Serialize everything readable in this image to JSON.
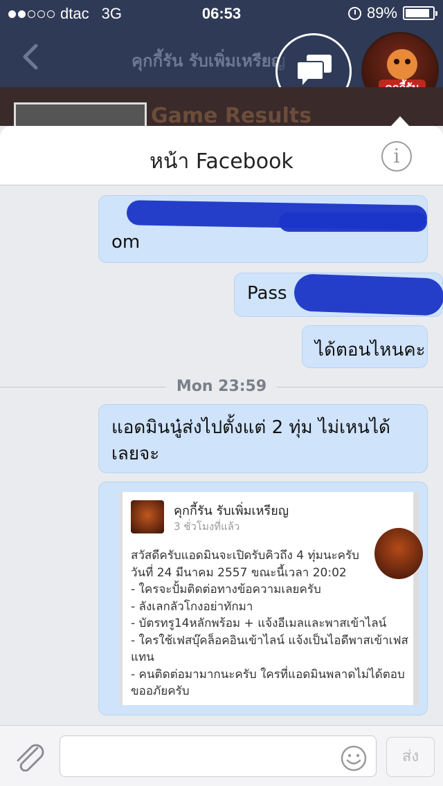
{
  "status_bar": {
    "carrier": "dtac",
    "network": "3G",
    "time": "06:53",
    "battery": "89%",
    "signal_dots_filled": 2,
    "signal_dots_total": 5,
    "battery_level": 0.89
  },
  "nav": {
    "title": "คุกกี้รัน รับเพิ่มเหรียญ",
    "back_icon": "chevron-left-icon",
    "chat_icon": "chat-bubbles-icon"
  },
  "peek": {
    "text": "Game Results"
  },
  "popover": {
    "title": "หน้า Facebook",
    "info_icon": "info-icon"
  },
  "messages": [
    {
      "text": "om"
    },
    {
      "text": "Pass"
    },
    {
      "text": "ได้ตอนไหนคะ"
    },
    {
      "text": "แอดมินนู๋ส่งไปตั้งแต่ 2 ทุ่ม ไม่เหนได้เลยจะ"
    }
  ],
  "timestamp": "Mon 23:59",
  "shared_post": {
    "name": "คุกกี้รัน รับเพิ่มเหรียญ",
    "time": "3 ชั่วโมงที่แล้ว",
    "lines": [
      "สวัสดีครับแอดมินจะเปิดรับคิวถึง 4 ทุ่มนะครับ",
      "วันที่ 24 มีนาคม 2557 ขณะนี้เวลา 20:02",
      "- ใครจะปั้มติดต่อทางข้อความเลยครับ",
      "- ลังเลกลัวโกงอย่าทักมา",
      "- บัตรทรู14หลักพร้อม + แจ้งอีเมลและพาสเข้าไลน์",
      "- ใครใช้เฟสบุ๊คล็อคอินเข้าไลน์ แจ้งเป็นไอดีพาสเข้าเฟส",
      "แทน",
      "- คนติดต่อมามากนะครับ ใครที่แอดมินพลาดไม่ได้ตอบ",
      "ขออภัยครับ"
    ]
  },
  "composer": {
    "placeholder": "",
    "send_label": "ส่ง",
    "attach_icon": "paperclip-icon",
    "emoji_icon": "smiley-icon"
  },
  "colors": {
    "nav_bg": "#2f3a57",
    "bubble_bg": "#cfe3fb",
    "background": "#e9ebee",
    "redaction": "#1a35c7"
  }
}
